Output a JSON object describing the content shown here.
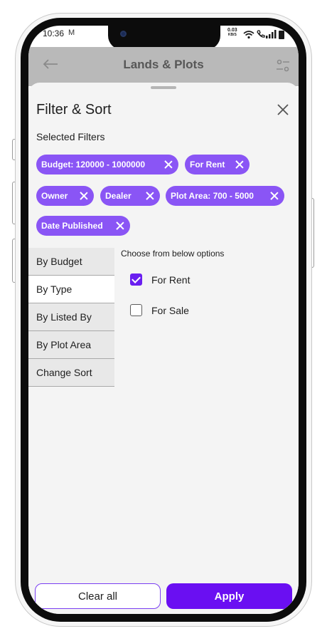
{
  "status_bar": {
    "time": "10:36",
    "mail_glyph": "M",
    "speed_value": "0.03",
    "speed_unit": "KB/S",
    "icons": "wifi-icon call-icon signal-icon battery-icon"
  },
  "app_header": {
    "title": "Lands & Plots"
  },
  "sheet": {
    "title": "Filter & Sort",
    "selected_filters_label": "Selected Filters",
    "chips": [
      {
        "label": "Budget: 120000 - 1000000"
      },
      {
        "label": "For Rent"
      },
      {
        "label": "Owner"
      },
      {
        "label": "Dealer"
      },
      {
        "label": "Plot Area: 700 - 5000"
      },
      {
        "label": "Date Published"
      }
    ],
    "tabs": [
      {
        "label": "By Budget",
        "active": false
      },
      {
        "label": "By Type",
        "active": true
      },
      {
        "label": "By Listed By",
        "active": false
      },
      {
        "label": "By Plot Area",
        "active": false
      },
      {
        "label": "Change Sort",
        "active": false
      }
    ],
    "options_label": "Choose from below options",
    "options": [
      {
        "label": "For Rent",
        "checked": true
      },
      {
        "label": "For Sale",
        "checked": false
      }
    ],
    "clear_label": "Clear all",
    "apply_label": "Apply"
  },
  "colors": {
    "accent": "#6a0ff2",
    "chip": "#8a55f5"
  }
}
